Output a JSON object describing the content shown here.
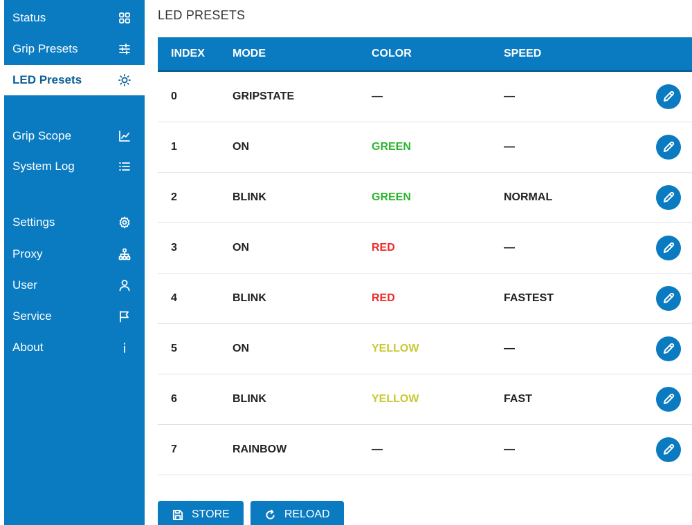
{
  "sidebar": {
    "items": [
      {
        "label": "Status",
        "icon": "dashboard-grid-icon"
      },
      {
        "label": "Grip Presets",
        "icon": "sliders-icon"
      },
      {
        "label": "LED Presets",
        "icon": "sun-icon",
        "active": true
      },
      {
        "label": "Grip Scope",
        "icon": "chart-icon"
      },
      {
        "label": "System Log",
        "icon": "list-icon"
      },
      {
        "label": "Settings",
        "icon": "gear-icon"
      },
      {
        "label": "Proxy",
        "icon": "network-icon"
      },
      {
        "label": "User",
        "icon": "user-icon"
      },
      {
        "label": "Service",
        "icon": "flag-icon"
      },
      {
        "label": "About",
        "icon": "info-icon"
      }
    ]
  },
  "page": {
    "title": "LED PRESETS"
  },
  "table": {
    "headers": {
      "index": "INDEX",
      "mode": "MODE",
      "color": "COLOR",
      "speed": "SPEED"
    },
    "rows": [
      {
        "index": "0",
        "mode": "GRIPSTATE",
        "color": "—",
        "speed": "—",
        "color_hex": "#222222"
      },
      {
        "index": "1",
        "mode": "ON",
        "color": "GREEN",
        "speed": "—",
        "color_hex": "#2db52d"
      },
      {
        "index": "2",
        "mode": "BLINK",
        "color": "GREEN",
        "speed": "NORMAL",
        "color_hex": "#2db52d"
      },
      {
        "index": "3",
        "mode": "ON",
        "color": "RED",
        "speed": "—",
        "color_hex": "#ee2a2a"
      },
      {
        "index": "4",
        "mode": "BLINK",
        "color": "RED",
        "speed": "FASTEST",
        "color_hex": "#ee2a2a"
      },
      {
        "index": "5",
        "mode": "ON",
        "color": "YELLOW",
        "speed": "—",
        "color_hex": "#c8c832"
      },
      {
        "index": "6",
        "mode": "BLINK",
        "color": "YELLOW",
        "speed": "FAST",
        "color_hex": "#c8c832"
      },
      {
        "index": "7",
        "mode": "RAINBOW",
        "color": "—",
        "speed": "—",
        "color_hex": "#222222"
      }
    ]
  },
  "actions": {
    "store_label": "STORE",
    "reload_label": "RELOAD"
  },
  "colors": {
    "accent": "#0a7bc1",
    "active_text": "#0a5f95"
  }
}
